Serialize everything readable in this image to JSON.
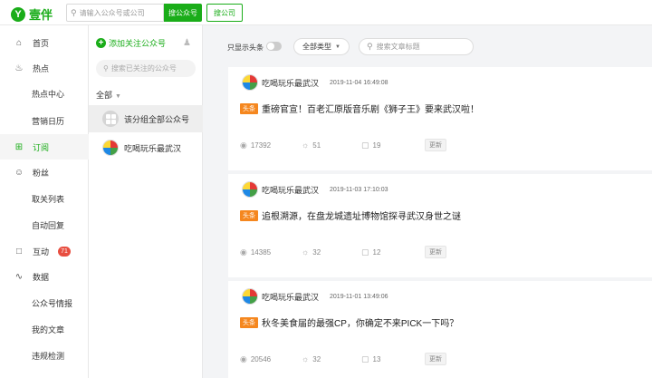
{
  "brand": {
    "logo_glyph": "Y",
    "name": "壹伴",
    "color": "#1aad19"
  },
  "topbar": {
    "search_placeholder": "请输入公众号或公司",
    "search_account_label": "搜公众号",
    "search_company_label": "搜公司"
  },
  "nav": {
    "home": "首页",
    "hot": "热点",
    "hot_center": "热点中心",
    "marketing_calendar": "营销日历",
    "subscribe": "订阅",
    "fans": "粉丝",
    "fan_list": "取关列表",
    "auto_reply": "自动回复",
    "interact": "互动",
    "interact_badge": "71",
    "data": "数据",
    "account_intel": "公众号情报",
    "my_articles": "我的文章",
    "violation_check": "违规检测"
  },
  "accounts": {
    "add_label": "添加关注公众号",
    "search_placeholder": "搜索已关注的公众号",
    "group_label": "全部",
    "group_all_label": "该分组全部公众号",
    "items": [
      {
        "name": "吃喝玩乐最武汉"
      }
    ]
  },
  "filters": {
    "toggle_label": "只显示头条",
    "type_select": "全部类型",
    "title_search_placeholder": "搜索文章标题"
  },
  "articles": [
    {
      "account": "吃喝玩乐最武汉",
      "time": "2019-11-04 16:49:08",
      "tag": "头条",
      "title": "重磅官宣！百老汇原版音乐剧《狮子王》要来武汉啦！",
      "views": "17392",
      "likes": "51",
      "comments": "19",
      "more": "更新"
    },
    {
      "account": "吃喝玩乐最武汉",
      "time": "2019-11-03 17:10:03",
      "tag": "头条",
      "title": "追根溯源，在盘龙城遗址博物馆探寻武汉身世之谜",
      "views": "14385",
      "likes": "32",
      "comments": "12",
      "more": "更新"
    },
    {
      "account": "吃喝玩乐最武汉",
      "time": "2019-11-01 13:49:06",
      "tag": "头条",
      "title": "秋冬美食届的最强CP，你确定不来PICK一下吗？",
      "views": "20546",
      "likes": "32",
      "comments": "13",
      "more": "更新"
    }
  ]
}
